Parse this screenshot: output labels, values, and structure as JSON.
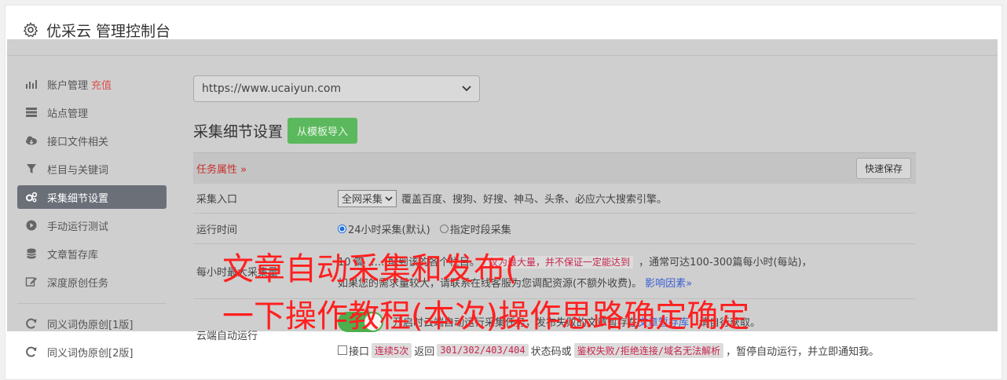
{
  "header": {
    "title": "优采云 管理控制台",
    "icon": "gear-icon"
  },
  "sidebar": {
    "items": [
      {
        "label": "账户管理",
        "badge": "充值",
        "icon": "bar-chart-icon"
      },
      {
        "label": "站点管理",
        "icon": "server-icon"
      },
      {
        "label": "接口文件相关",
        "icon": "cloud-download-icon"
      },
      {
        "label": "栏目与关键词",
        "icon": "filter-icon"
      },
      {
        "label": "采集细节设置",
        "icon": "cogs-icon",
        "active": true
      },
      {
        "label": "手动运行测试",
        "icon": "play-circle-icon"
      },
      {
        "label": "文章暂存库",
        "icon": "database-icon"
      },
      {
        "label": "深度原创任务",
        "icon": "edit-icon"
      }
    ],
    "items2": [
      {
        "label": "同义词伪原创[1版]",
        "icon": "refresh-icon"
      },
      {
        "label": "同义词伪原创[2版]",
        "icon": "refresh-icon"
      }
    ]
  },
  "main": {
    "site_select": "https://www.ucaiyun.com",
    "section_title": "采集细节设置",
    "template_button": "从模板导入",
    "props_label": "任务属性 »",
    "quick_save": "快速保存",
    "rows": {
      "entry": {
        "label": "采集入口",
        "select": "全网采集",
        "desc": "覆盖百度、搜狗、好搜、神马、头条、必应六大搜索引擎。"
      },
      "time": {
        "label": "运行时间",
        "opt1": "24小时采集(默认)",
        "opt2": "指定时段采集"
      },
      "max": {
        "label": "每小时最大采集量",
        "line1_pre": "10",
        "line1_mid": "篇 ……配到该的各个栏目。",
        "tag1": "仅为最大量，并不保证一定能达到",
        "line1_post": "，通常可达100-300篇每小时(每站)，",
        "line2": "如果您的需求量较大，请联系在线客服为您调配资源(不额外收费)。",
        "link": "影响因素»"
      },
      "cloud": {
        "label": "云端自动运行",
        "line1": "开启时云端自动运行采集任务，发布失败的文章暂存在",
        "link1": "文章暂存库",
        "line1_post": "，请自行获取。",
        "chk_pre": "接口",
        "tag_a": "连续5次",
        "mid1": "返回",
        "tag_b": "301/302/403/404",
        "mid2": "状态码或",
        "tag_c": "鉴权失败/拒绝连接/域名无法解析",
        "tail": "，暂停自动运行，并立即通知我。"
      }
    }
  },
  "overlay": {
    "line1": "文章自动采集和发布(",
    "line2": "一下操作教程(本次)操作思路确定确定"
  },
  "colors": {
    "accent_green": "#5cb85c",
    "accent_red": "#c9302c",
    "overlay_red": "#ff2020",
    "active_item": "#6b6f78"
  }
}
